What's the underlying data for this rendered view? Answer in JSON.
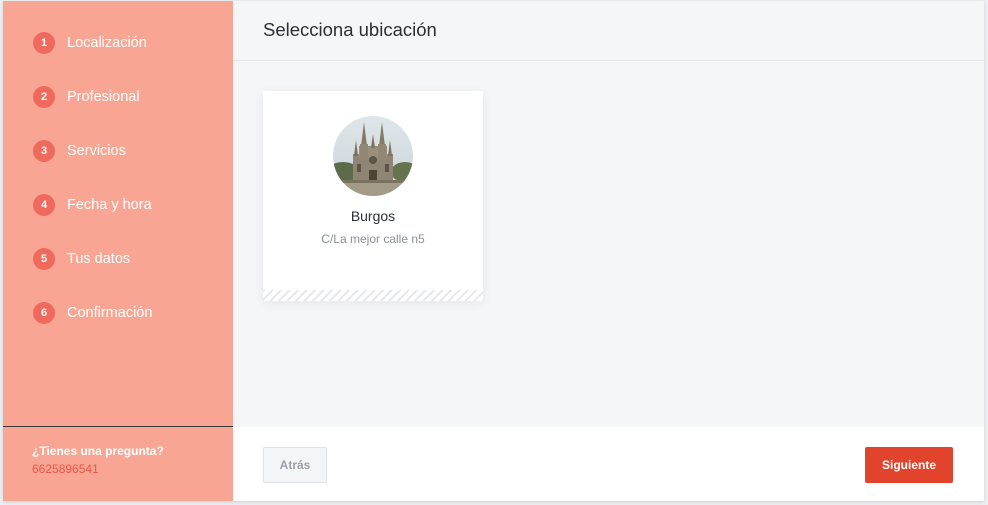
{
  "sidebar": {
    "steps": [
      {
        "number": "1",
        "label": "Localización"
      },
      {
        "number": "2",
        "label": "Profesional"
      },
      {
        "number": "3",
        "label": "Servicios"
      },
      {
        "number": "4",
        "label": "Fecha y hora"
      },
      {
        "number": "5",
        "label": "Tus datos"
      },
      {
        "number": "6",
        "label": "Confirmación"
      }
    ],
    "footer": {
      "question": "¿Tienes una pregunta?",
      "phone": "6625896541"
    }
  },
  "main": {
    "title": "Selecciona ubicación",
    "locations": [
      {
        "name": "Burgos",
        "address": "C/La mejor calle n5",
        "image": "cathedral-photo"
      }
    ]
  },
  "footer": {
    "back_label": "Atrás",
    "next_label": "Siguiente"
  },
  "colors": {
    "sidebar_bg": "#f9a593",
    "step_badge": "#ef6a5d",
    "phone_text": "#e8574a",
    "primary_button": "#e2432d",
    "content_bg": "#f5f6f8"
  }
}
